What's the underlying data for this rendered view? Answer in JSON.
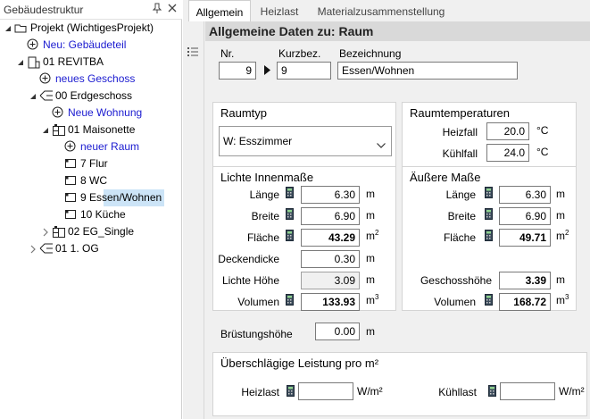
{
  "left_panel": {
    "title": "Gebäudestruktur",
    "pin_icon": "pin-icon",
    "close_icon": "close-icon",
    "tree": [
      {
        "label": "Projekt (WichtigesProjekt)",
        "icon": "project-icon",
        "expanded": true
      },
      {
        "label": "Neu: Gebäudeteil",
        "icon": "add-icon",
        "action": true
      },
      {
        "label": "01 REVITBA",
        "icon": "building-icon",
        "expanded": true
      },
      {
        "label": "neues Geschoss",
        "icon": "add-icon",
        "action": true
      },
      {
        "label": "00 Erdgeschoss",
        "icon": "floor-icon",
        "expanded": true
      },
      {
        "label": "Neue Wohnung",
        "icon": "add-icon",
        "action": true
      },
      {
        "label": "01 Maisonette",
        "icon": "apartment-icon",
        "expanded": true
      },
      {
        "label": "neuer Raum",
        "icon": "add-icon",
        "action": true
      },
      {
        "label": "7 Flur",
        "icon": "room-icon"
      },
      {
        "label": "8 WC",
        "icon": "room-icon"
      },
      {
        "label": "9 Essen/Wohnen",
        "icon": "room-icon",
        "selected": true
      },
      {
        "label": "10 Küche",
        "icon": "room-icon"
      },
      {
        "label": "02 EG_Single",
        "icon": "apartment-icon",
        "expanded": false
      },
      {
        "label": "01 1. OG",
        "icon": "floor-icon",
        "expanded": false
      }
    ]
  },
  "tabs": [
    "Allgemein",
    "Heizlast",
    "Materialzusammenstellung"
  ],
  "active_tab": "Allgemein",
  "page_title": "Allgemeine Daten zu: Raum",
  "header_fields": {
    "nr_label": "Nr.",
    "nr_value": "9",
    "kurz_label": "Kurzbez.",
    "kurz_value": "9",
    "bez_label": "Bezeichnung",
    "bez_value": "Essen/Wohnen"
  },
  "raumtyp": {
    "title": "Raumtyp",
    "value": "W: Esszimmer"
  },
  "raumtemperaturen": {
    "title": "Raumtemperaturen",
    "heizfall_label": "Heizfall",
    "heizfall_value": "20.0",
    "kuehlfall_label": "Kühlfall",
    "kuehlfall_value": "24.0",
    "unit": "°C"
  },
  "lichte": {
    "title": "Lichte Innenmaße",
    "laenge_label": "Länge",
    "laenge_value": "6.30",
    "breite_label": "Breite",
    "breite_value": "6.90",
    "flaeche_label": "Fläche",
    "flaeche_value": "43.29",
    "deckendicke_label": "Deckendicke",
    "deckendicke_value": "0.30",
    "hoehe_label": "Lichte Höhe",
    "hoehe_value": "3.09",
    "volumen_label": "Volumen",
    "volumen_value": "133.93",
    "unit_m": "m",
    "unit_m2": "m",
    "unit_m3": "m",
    "sup2": "2",
    "sup3": "3"
  },
  "aeussere": {
    "title": "Äußere Maße",
    "laenge_label": "Länge",
    "laenge_value": "6.30",
    "breite_label": "Breite",
    "breite_value": "6.90",
    "flaeche_label": "Fläche",
    "flaeche_value": "49.71",
    "geschoss_label": "Geschosshöhe",
    "geschoss_value": "3.39",
    "volumen_label": "Volumen",
    "volumen_value": "168.72",
    "unit_m": "m"
  },
  "bruestung": {
    "label": "Brüstungshöhe",
    "value": "0.00",
    "unit": "m"
  },
  "leistung": {
    "title": "Überschlägige Leistung pro m²",
    "heizlast_label": "Heizlast",
    "heizlast_value": "",
    "kuehllast_label": "Kühllast",
    "kuehllast_value": "",
    "unit": "W/m²"
  },
  "colors": {
    "selection": "#cce4f7",
    "link_blue": "#1b1bd0",
    "panel_bg": "#f0f0f0",
    "title_bar": "#d9d9d9"
  }
}
